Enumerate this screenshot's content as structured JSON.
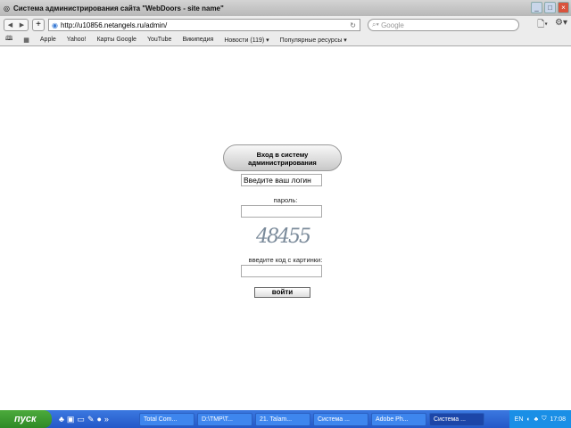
{
  "window": {
    "title": "Система администрирования сайта \"WebDoors - site name\""
  },
  "toolbar": {
    "url": "http://u10856.netangels.ru/admin/",
    "search_placeholder": "Google"
  },
  "bookmarks": [
    "Apple",
    "Yahoo!",
    "Карты Google",
    "YouTube",
    "Википедия",
    "Новости (119) ▾",
    "Популярные ресурсы ▾"
  ],
  "login": {
    "heading": "Вход в систему администрирования",
    "login_value": "Введите ваш логин",
    "password_label": "пароль:",
    "captcha_text": "48455",
    "captcha_label": "введите код с картинки:",
    "submit": "войти"
  },
  "taskbar": {
    "start": "пуск",
    "tasks": [
      "Total Com...",
      "D:\\TMP\\T...",
      "21. Talam...",
      "Система ...",
      "Adobe Ph...",
      "Система ..."
    ],
    "lang": "EN",
    "clock": "17:08"
  }
}
